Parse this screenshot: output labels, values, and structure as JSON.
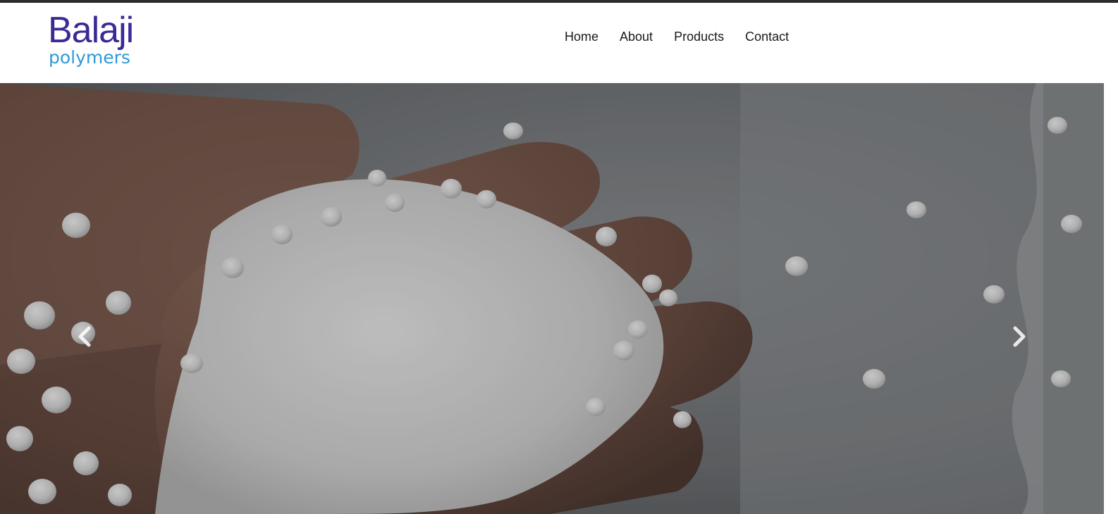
{
  "brand": {
    "name": "Balaji",
    "tagline": "polymers",
    "primary_color": "#3b2a95",
    "secondary_color": "#2f9ad6"
  },
  "nav": {
    "items": [
      {
        "label": "Home"
      },
      {
        "label": "About"
      },
      {
        "label": "Products"
      },
      {
        "label": "Contact"
      }
    ]
  },
  "hero": {
    "image": "hand-holding-white-plastic-granules",
    "prev_icon": "chevron-left-icon",
    "next_icon": "chevron-right-icon"
  }
}
